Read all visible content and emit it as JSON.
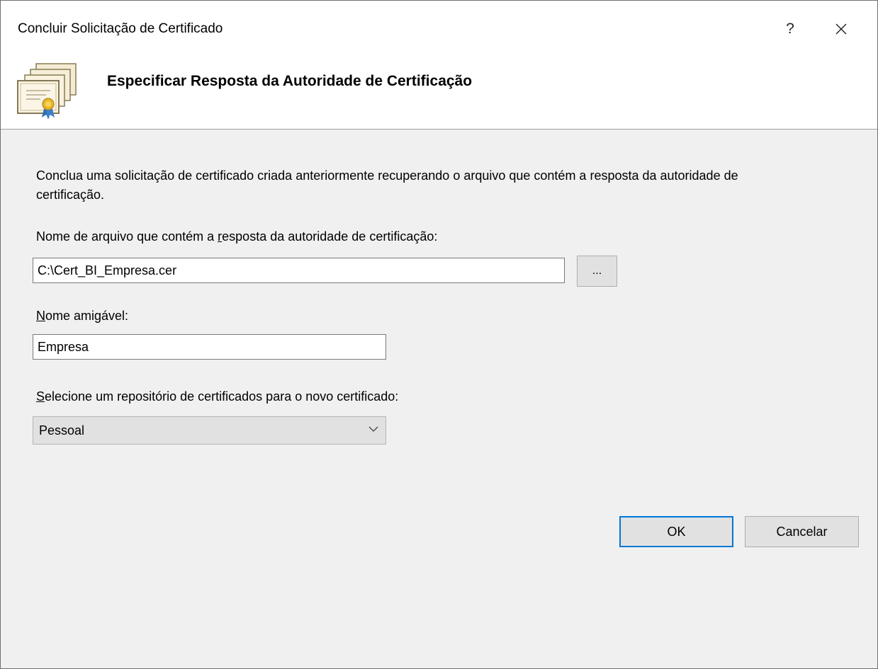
{
  "window": {
    "title": "Concluir Solicitação de Certificado",
    "help_label": "?",
    "close_label": "✕"
  },
  "header": {
    "title": "Especificar Resposta da Autoridade de Certificação",
    "icon": "certificate-stack-icon"
  },
  "body": {
    "description": "Conclua uma solicitação de certificado criada anteriormente recuperando o arquivo que contém a resposta da autoridade de certificação.",
    "file_label": {
      "before": "Nome de arquivo que contém a ",
      "accel": "r",
      "after": "esposta da autoridade de certificação:"
    },
    "file_value": "C:\\Cert_BI_Empresa.cer",
    "browse_label": "...",
    "name_label": {
      "accel": "N",
      "after": "ome amigável:"
    },
    "name_value": "Empresa",
    "store_label": {
      "accel": "S",
      "after": "elecione um repositório de certificados para o novo certificado:"
    },
    "store_selected": "Pessoal"
  },
  "buttons": {
    "ok": "OK",
    "cancel": "Cancelar"
  },
  "colors": {
    "accent": "#0078d7",
    "window_bg": "#f0f0f0",
    "header_bg": "#ffffff"
  }
}
